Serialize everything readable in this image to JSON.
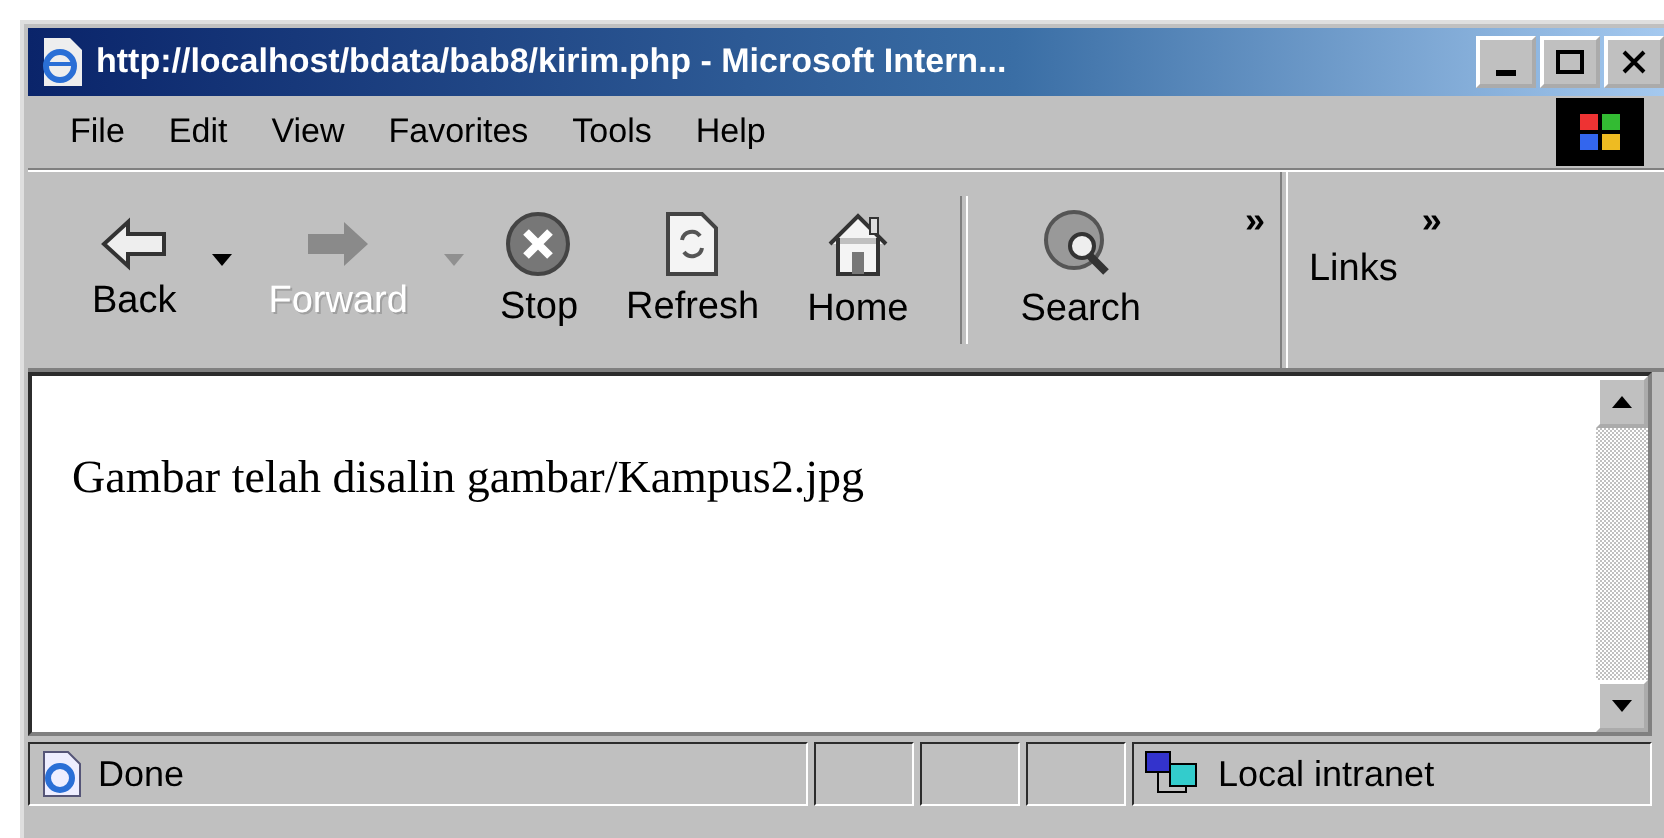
{
  "window": {
    "title": "http://localhost/bdata/bab8/kirim.php - Microsoft Intern..."
  },
  "menu": [
    "File",
    "Edit",
    "View",
    "Favorites",
    "Tools",
    "Help"
  ],
  "toolbar": [
    {
      "kind": "back",
      "label": "Back",
      "disabled": false,
      "dropdown": true
    },
    {
      "kind": "forward",
      "label": "Forward",
      "disabled": true,
      "dropdown": true
    },
    {
      "kind": "stop",
      "label": "Stop",
      "disabled": false,
      "dropdown": false
    },
    {
      "kind": "refresh",
      "label": "Refresh",
      "disabled": false,
      "dropdown": false
    },
    {
      "kind": "home",
      "label": "Home",
      "disabled": false,
      "dropdown": false
    },
    {
      "kind": "search",
      "label": "Search",
      "disabled": false,
      "dropdown": false
    }
  ],
  "toolbar_chevron": "»",
  "links": {
    "label": "Links",
    "chevron": "»"
  },
  "content": {
    "text": "Gambar telah disalin gambar/Kampus2.jpg"
  },
  "status_bar": {
    "status": "Done",
    "zone": "Local intranet"
  }
}
